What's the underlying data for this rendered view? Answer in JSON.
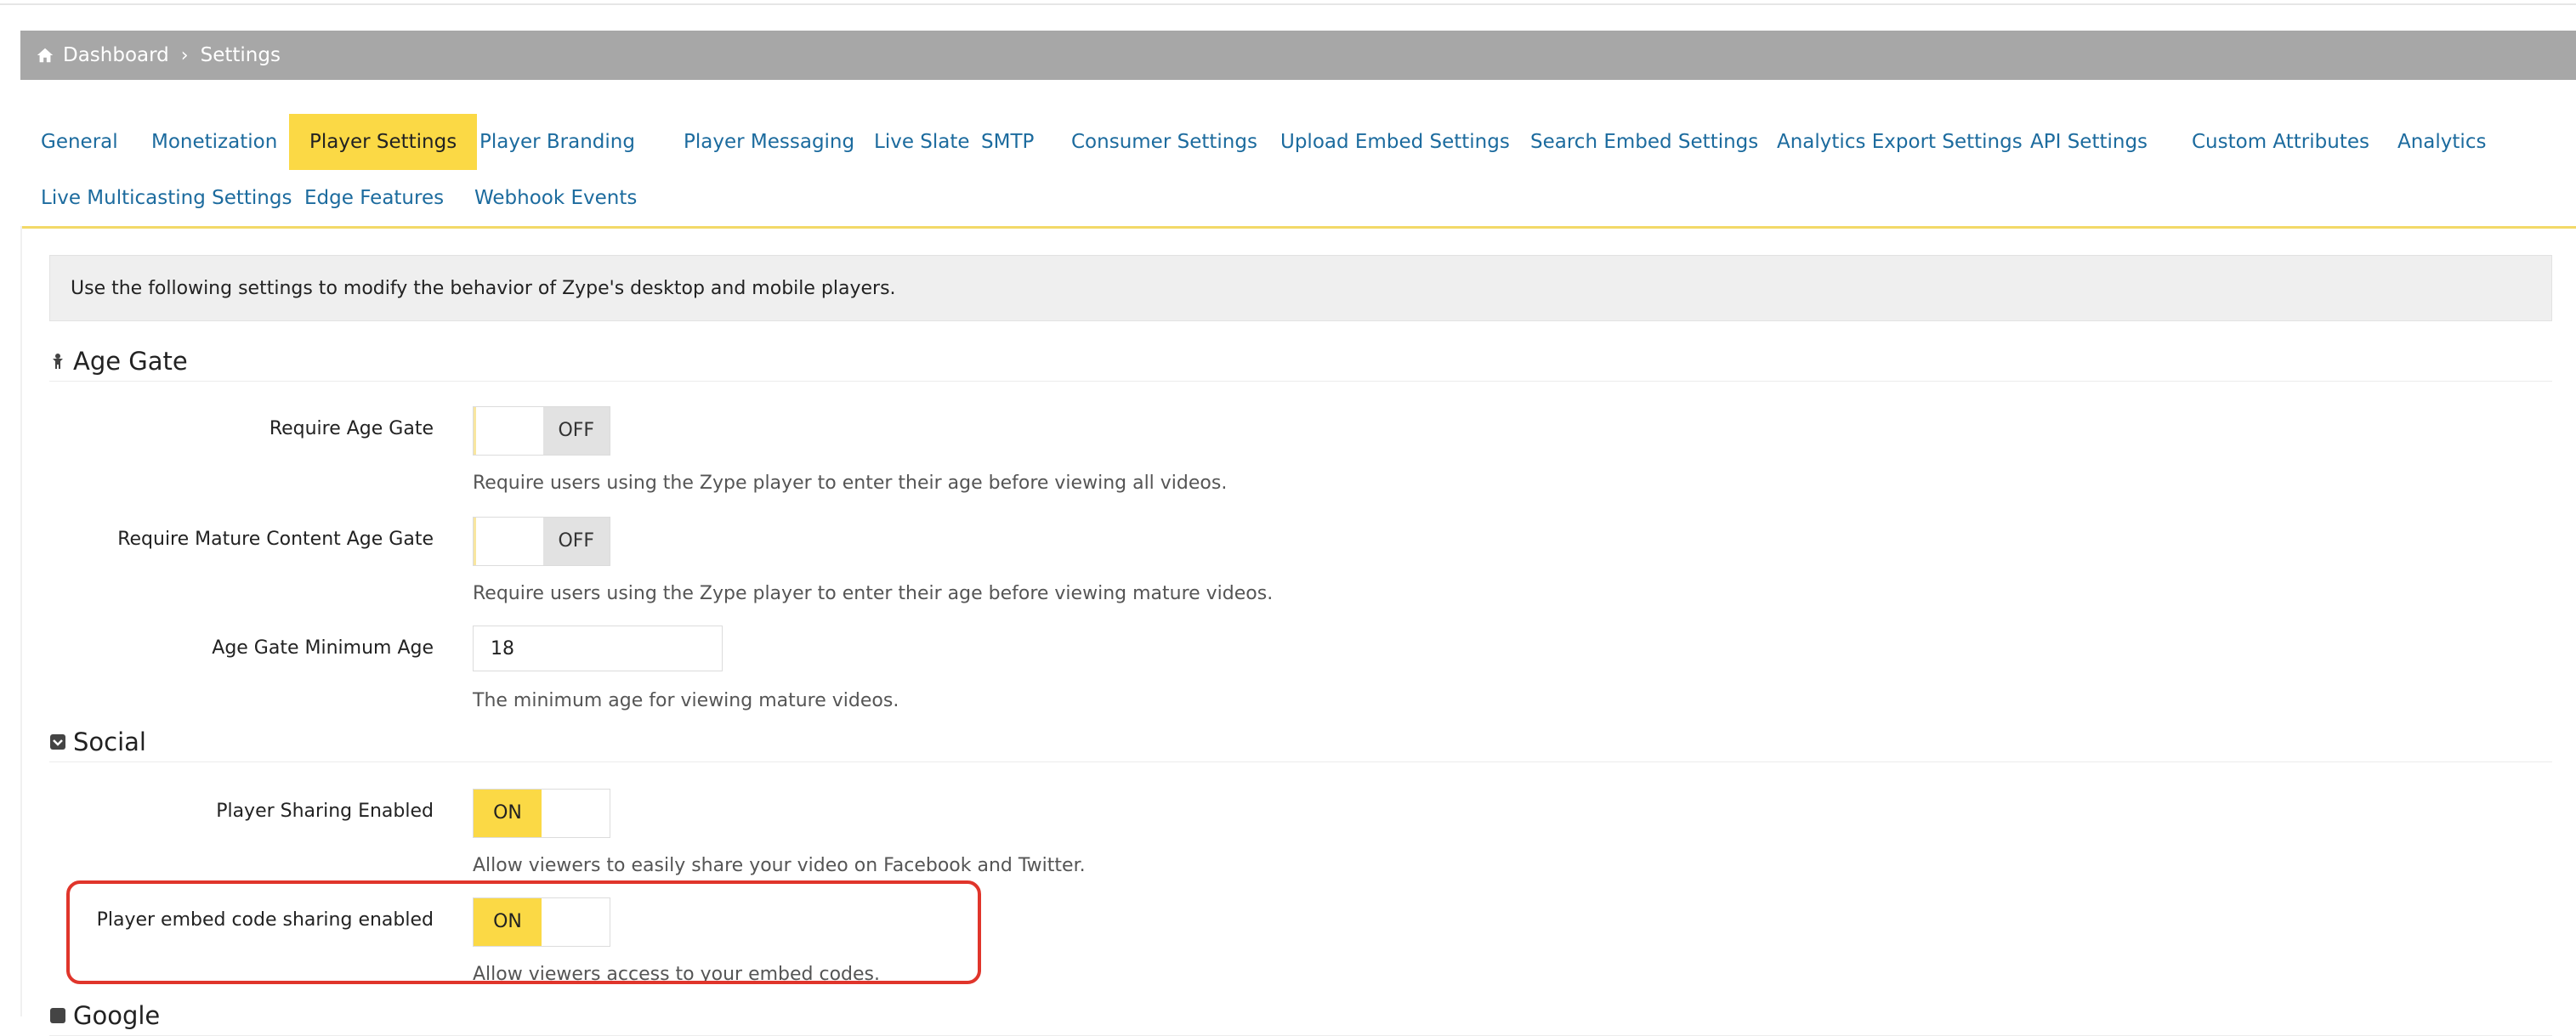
{
  "breadcrumb": {
    "items": [
      "Dashboard",
      "Settings"
    ],
    "separator": "›"
  },
  "tabs": [
    {
      "label": "General"
    },
    {
      "label": "Monetization"
    },
    {
      "label": "Player Settings",
      "active": true
    },
    {
      "label": "Player Branding"
    },
    {
      "label": "Player Messaging"
    },
    {
      "label": "Live Slate"
    },
    {
      "label": "SMTP"
    },
    {
      "label": "Consumer Settings"
    },
    {
      "label": "Upload Embed Settings"
    },
    {
      "label": "Search Embed Settings"
    },
    {
      "label": "Analytics Export Settings"
    },
    {
      "label": "API Settings"
    },
    {
      "label": "Custom Attributes"
    },
    {
      "label": "Analytics"
    },
    {
      "label": "Live Multicasting Settings"
    },
    {
      "label": "Edge Features"
    },
    {
      "label": "Webhook Events"
    }
  ],
  "notice": "Use the following settings to modify the behavior of Zype's desktop and mobile players.",
  "sections": {
    "age_gate": {
      "title": "Age Gate",
      "require_age_gate": {
        "label": "Require Age Gate",
        "state": "OFF",
        "help": "Require users using the Zype player to enter their age before viewing all videos."
      },
      "require_mature": {
        "label": "Require Mature Content Age Gate",
        "state": "OFF",
        "help": "Require users using the Zype player to enter their age before viewing mature videos."
      },
      "min_age": {
        "label": "Age Gate Minimum Age",
        "value": "18",
        "help": "The minimum age for viewing mature videos."
      }
    },
    "social": {
      "title": "Social",
      "player_sharing": {
        "label": "Player Sharing Enabled",
        "state": "ON",
        "help": "Allow viewers to easily share your video on Facebook and Twitter."
      },
      "embed_sharing": {
        "label": "Player embed code sharing enabled",
        "state": "ON",
        "help": "Allow viewers access to your embed codes."
      }
    },
    "google": {
      "title": "Google"
    }
  },
  "colors": {
    "accent": "#fbd945",
    "link": "#1c6b9e",
    "breadcrumb_bg": "#a7a7a7",
    "highlight": "#e0352b"
  },
  "icons": {
    "home": "home-icon",
    "age_gate": "child-icon",
    "social": "share-square-icon"
  }
}
